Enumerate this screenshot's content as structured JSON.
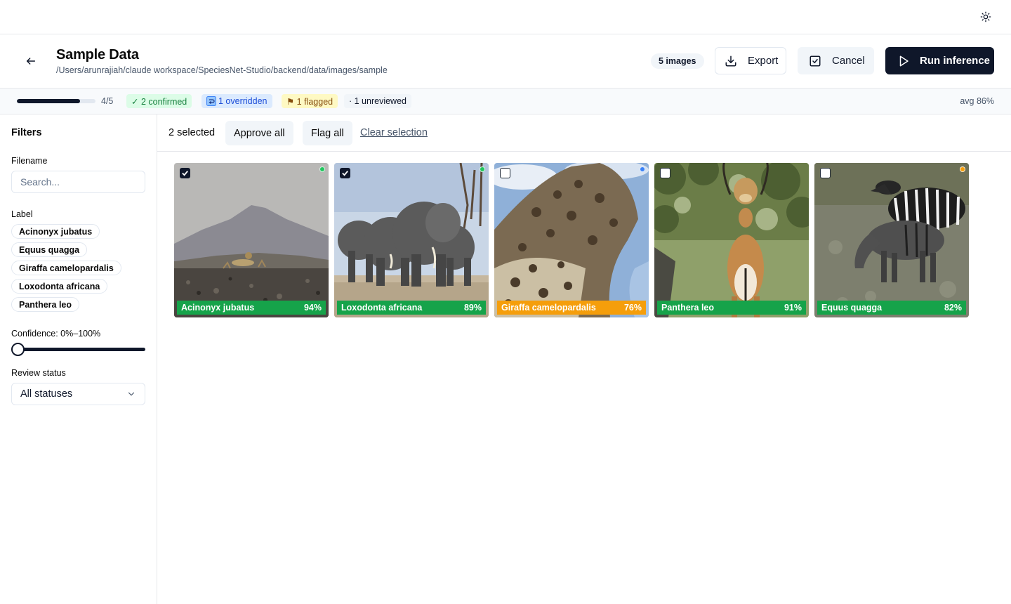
{
  "header": {
    "title": "Sample Data",
    "path": "/Users/arunrajiah/claude workspace/SpeciesNet-Studio/backend/data/images/sample",
    "image_count": "5 images",
    "export_label": "Export",
    "cancel_label": "Cancel",
    "run_label": "Run inference"
  },
  "progress": {
    "fraction": 0.8,
    "count_text": "4/5",
    "confirmed": "✓ 2 confirmed",
    "overridden": "1 overridden",
    "flagged": "⚑ 1 flagged",
    "unreviewed": "· 1 unreviewed",
    "avg": "avg 86%"
  },
  "filters": {
    "title": "Filters",
    "filename_label": "Filename",
    "search_placeholder": "Search...",
    "label_title": "Label",
    "labels": [
      "Acinonyx jubatus",
      "Equus quagga",
      "Giraffa camelopardalis",
      "Loxodonta africana",
      "Panthera leo"
    ],
    "confidence_label": "Confidence: 0%–100%",
    "confidence_min": 0,
    "confidence_max": 100,
    "review_label": "Review status",
    "review_value": "All statuses"
  },
  "selection": {
    "count": "2 selected",
    "approve_label": "Approve all",
    "flag_label": "Flag all",
    "clear_label": "Clear selection"
  },
  "colors": {
    "high": "#16a34a",
    "medium": "#f59e0b",
    "confirmed_dot": "#22c55e",
    "overridden_dot": "#3b82f6",
    "flagged_dot": "#f59e0b"
  },
  "images": [
    {
      "species": "Acinonyx jubatus",
      "confidence": "94%",
      "selected": true,
      "status": "confirmed",
      "label_color": "#16a34a",
      "dot_color": "#22c55e"
    },
    {
      "species": "Loxodonta africana",
      "confidence": "89%",
      "selected": true,
      "status": "confirmed",
      "label_color": "#16a34a",
      "dot_color": "#22c55e"
    },
    {
      "species": "Giraffa camelopardalis",
      "confidence": "76%",
      "selected": false,
      "status": "overridden",
      "label_color": "#f59e0b",
      "dot_color": "#3b82f6"
    },
    {
      "species": "Panthera leo",
      "confidence": "91%",
      "selected": false,
      "status": "unreviewed",
      "label_color": "#16a34a",
      "dot_color": null
    },
    {
      "species": "Equus quagga",
      "confidence": "82%",
      "selected": false,
      "status": "flagged",
      "label_color": "#16a34a",
      "dot_color": "#f59e0b"
    }
  ]
}
